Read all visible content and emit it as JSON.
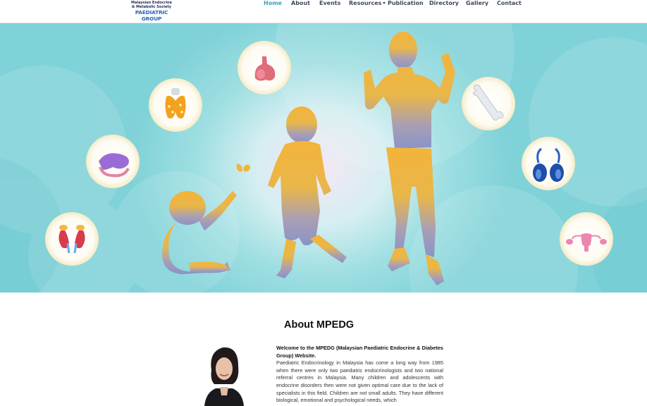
{
  "logo": {
    "line1": "Malaysian Endocrine",
    "line2": "& Metabolic Society",
    "line3": "PAEDIATRIC GROUP"
  },
  "nav": {
    "items": [
      {
        "label": "Home",
        "active": true
      },
      {
        "label": "About"
      },
      {
        "label": "Events"
      },
      {
        "label": "Resources",
        "has_dropdown": true
      },
      {
        "label": "Publication"
      },
      {
        "label": "Directory"
      },
      {
        "label": "Gallery"
      },
      {
        "label": "Contact"
      }
    ]
  },
  "colors": {
    "accent": "#3aa0b6",
    "hero_teal": "#8ad6dc",
    "figure_top": "#f2b43a",
    "figure_bottom": "#8f96c8"
  },
  "hero": {
    "icons": [
      "pituitary-icon",
      "thyroid-icon",
      "pancreas-icon",
      "kidney-adrenal-icon",
      "bone-icon",
      "testes-icon",
      "ovaries-uterus-icon",
      "butterfly-icon"
    ]
  },
  "about": {
    "title": "About MPEDG",
    "lead": "Welcome to the MPEDG (Malaysian Paediatric Endocrine & Diabetes Group) Website.",
    "body": "Paediatric Endocrinology in Malaysia has come a long way from 1985 when there were only two paediatric endocrinologists and two national referral centres in Malaysia. Many children and adolescents with endocrine disorders then were not given optimal care due to the lack of specialists in this field. Children are not small adults. They have different biological, emotional and psychological needs, which"
  }
}
